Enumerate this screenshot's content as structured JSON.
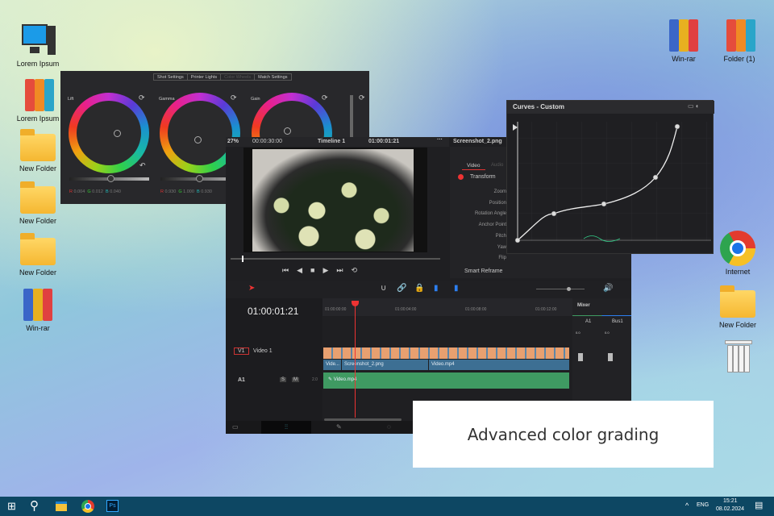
{
  "desktop": {
    "left_icons": [
      "Lorem Ipsum",
      "Lorem Ipsum",
      "New Folder",
      "New Folder",
      "New Folder",
      "Win-rar"
    ],
    "right_icons": [
      "Win-rar",
      "Folder (1)",
      "Internet",
      "New Folder"
    ]
  },
  "color_wheels": {
    "tabs": [
      "Shot Settings",
      "Printer Lights",
      "Color Wheels",
      "Match Settings"
    ],
    "wheels": [
      {
        "label": "Lift",
        "values": [
          "0.004",
          "0.012",
          "0.040"
        ]
      },
      {
        "label": "Gamma",
        "values": [
          "0.930",
          "1.000",
          "0.930"
        ]
      },
      {
        "label": "Gain",
        "values": []
      }
    ]
  },
  "viewer": {
    "zoom": "27%",
    "duration": "00:00:30:00",
    "timeline": "Timeline 1",
    "timecode": "01:00:01:21",
    "clip_name": "Screenshot_2.png"
  },
  "inspector": {
    "tabs": [
      "Video",
      "Audio"
    ],
    "section": "Transform",
    "rows": [
      "Zoom",
      "Position",
      "Rotation Angle",
      "Anchor Point",
      "Pitch",
      "Yaw",
      "Flip"
    ],
    "collapsed": "Smart Reframe"
  },
  "timeline": {
    "timecode": "01:00:01:21",
    "ruler": [
      "01:00:00:00",
      "01:00:04:00",
      "01:00:08:00",
      "01:00:12:00"
    ],
    "video_track": {
      "id": "V1",
      "name": "Video 1",
      "clips": [
        "Vide...",
        "Screenshot_2.png",
        "Video.mp4"
      ]
    },
    "audio_track": {
      "id": "A1",
      "level": "2.0",
      "clip": "Video.mp4",
      "buttons": [
        "S",
        "M"
      ]
    }
  },
  "mixer": {
    "title": "Mixer",
    "channels": [
      "A1",
      "Bus1"
    ],
    "levels": [
      "0.0",
      "0.0"
    ]
  },
  "curves": {
    "title": "Curves - Custom"
  },
  "caption": "Advanced color grading",
  "taskbar": {
    "lang": "ENG",
    "time": "15:21",
    "date": "08.02.2024"
  },
  "colors": {
    "accent": "#e64545",
    "taskbar": "#0d4763",
    "audio_clip": "#3f9a62",
    "video_clip": "#3d6f93"
  }
}
